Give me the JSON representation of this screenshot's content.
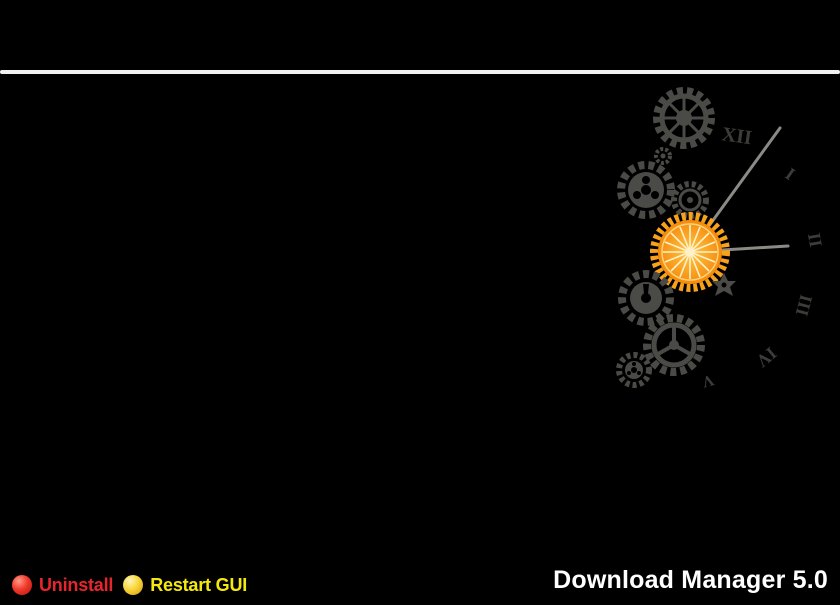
{
  "header": {
    "divider_color": "#f2f2f2"
  },
  "artwork": {
    "description_icon": "clockwork-gears-icon",
    "numerals": [
      "XII",
      "I",
      "II",
      "III",
      "IV",
      "V"
    ],
    "accent_gear_color": "#f7a21b",
    "dark_gear_color": "#4a4a46"
  },
  "footer": {
    "uninstall": {
      "label": "Uninstall",
      "icon": "red-orb-icon",
      "color": "#e8252b"
    },
    "restart": {
      "label": "Restart GUI",
      "icon": "yellow-orb-icon",
      "color": "#f5e90c"
    },
    "app_title": "Download Manager 5.0"
  }
}
